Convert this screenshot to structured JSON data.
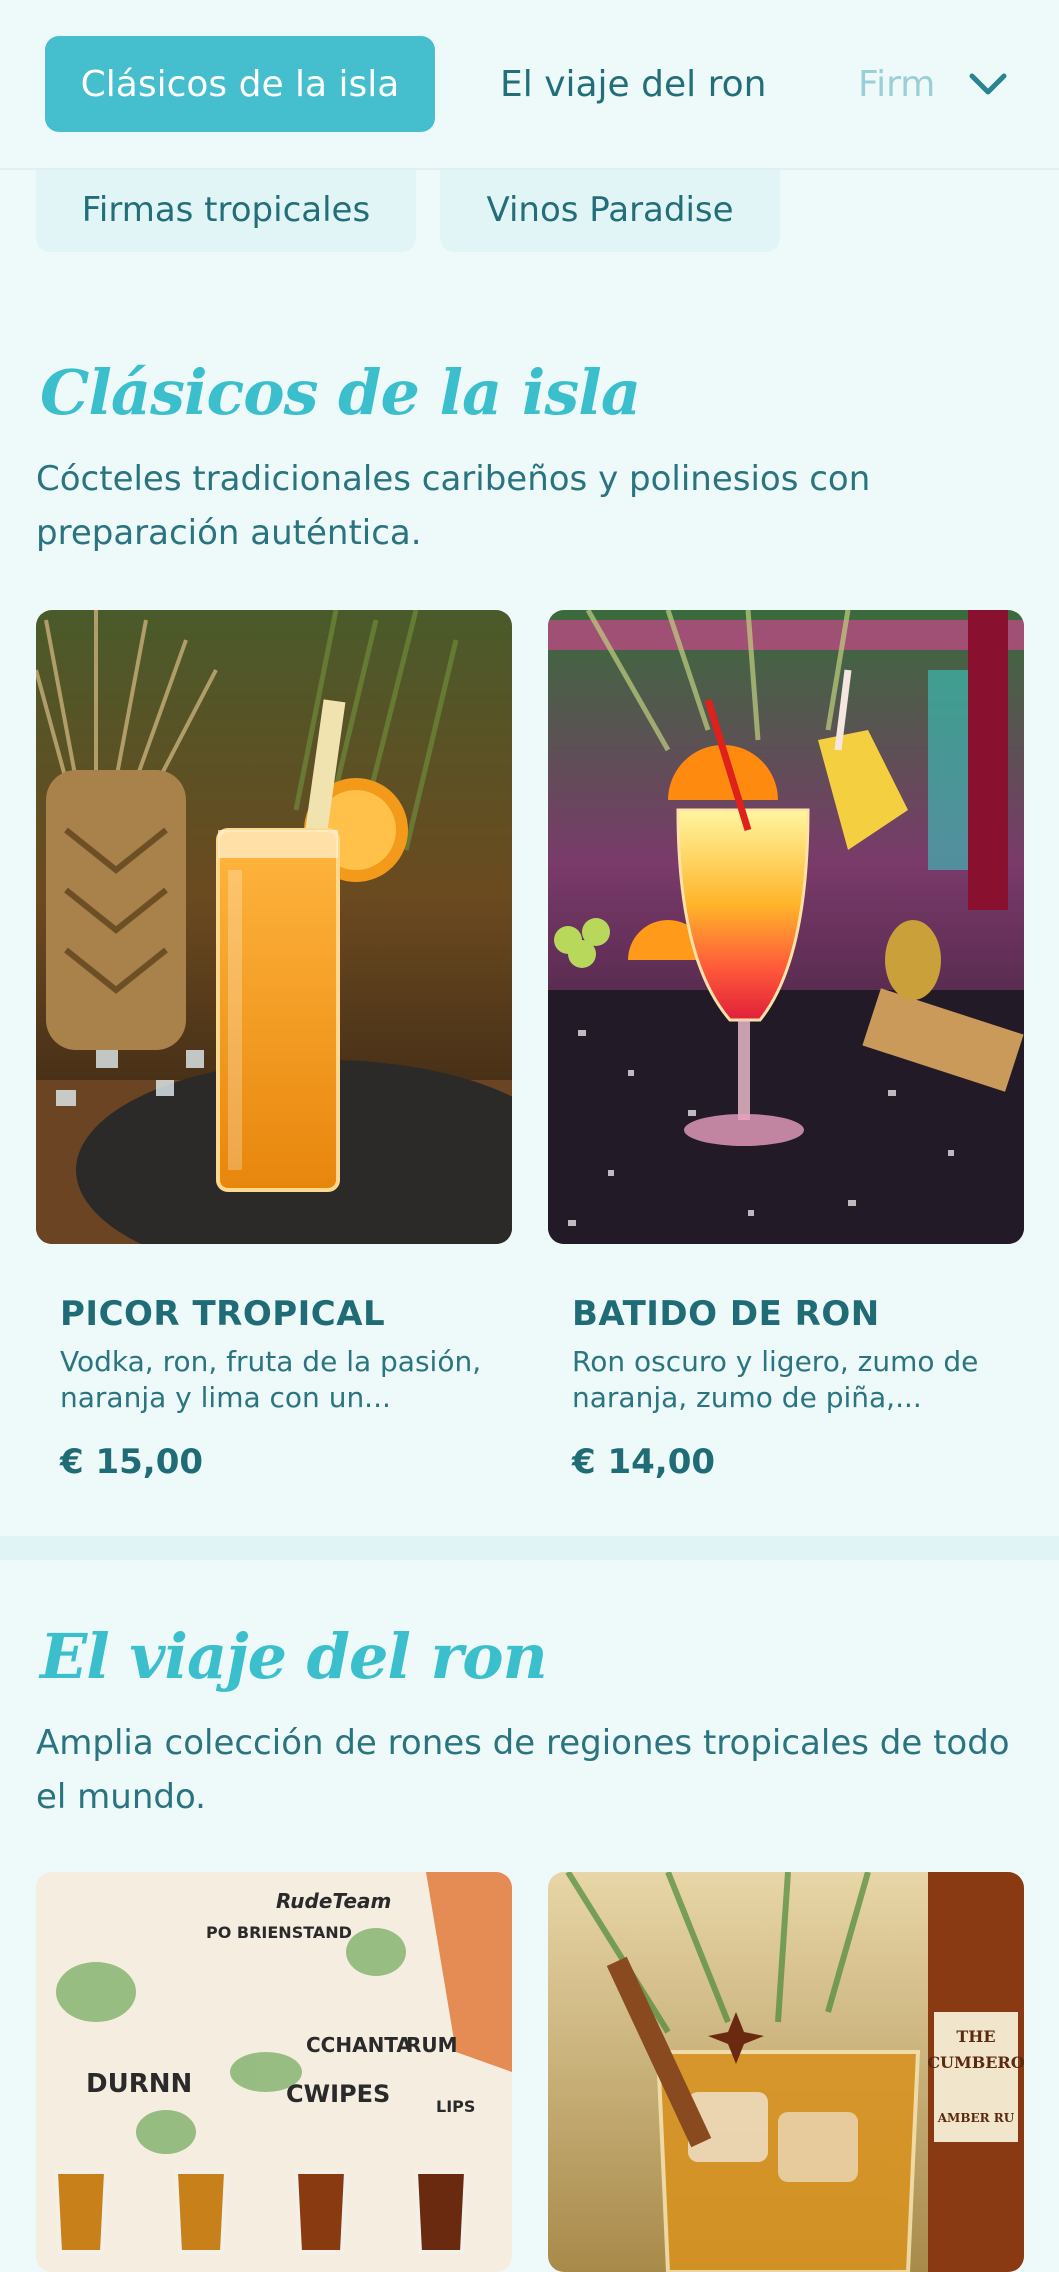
{
  "nav": {
    "tabs": [
      {
        "label": "Clásicos de la isla",
        "active": true
      },
      {
        "label": "El viaje del ron",
        "active": false
      },
      {
        "label": "Firmas tropicales",
        "active": false
      },
      {
        "label": "Vinos Paradise",
        "active": false
      }
    ],
    "overflow_visible": "Firm",
    "expand_icon": "chevron-down-icon"
  },
  "sections": [
    {
      "title": "Clásicos de la isla",
      "description": "Cócteles tradicionales caribeños y polinesios con preparación auténtica.",
      "items": [
        {
          "name": "PICOR TROPICAL",
          "description": "Vodka, ron, fruta de la pasión, naranja y lima con un...",
          "price": "€ 15,00"
        },
        {
          "name": "BATIDO DE RON",
          "description": "Ron oscuro y ligero, zumo de naranja, zumo de piña,...",
          "price": "€ 14,00"
        }
      ]
    },
    {
      "title": "El viaje del ron",
      "description": "Amplia colección de rones de regiones tropicales de todo el mundo.",
      "items": [
        {
          "image_text": [
            "RudeTeam",
            "PO BRIENSTAND",
            "CCHANTA",
            "RUM",
            "DURNN",
            "CWIPES",
            "LIPS"
          ]
        },
        {
          "image_text": [
            "THE",
            "CUMBERO",
            "AMBER RU"
          ]
        }
      ]
    }
  ],
  "colors": {
    "accent": "#45bfcd",
    "background": "#eef9fa",
    "text": "#1f6f7a",
    "title": "#3bbfcc"
  }
}
